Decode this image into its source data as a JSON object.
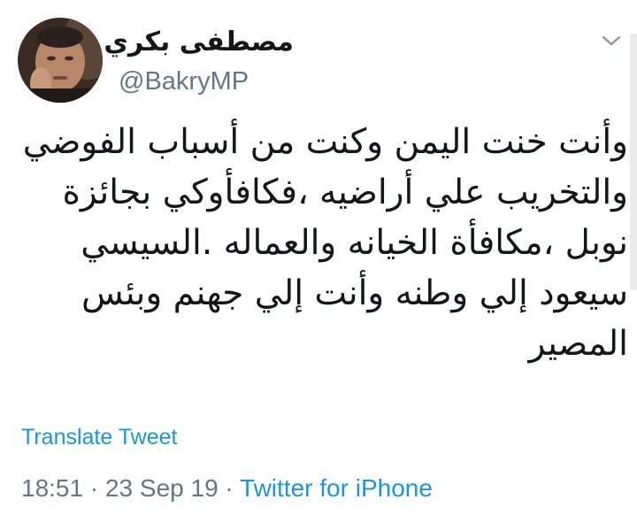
{
  "tweet": {
    "author": {
      "display_name": "مصطفى بكري",
      "handle": "@BakryMP",
      "verified": true,
      "verified_icon": "verified-badge-icon"
    },
    "menu_icon": "chevron-down-icon",
    "text_lines": [
      "وأنت خنت اليمن وكنت من أسباب الفوضي",
      "والتخريب علي أراضيه ،فكافأوكي بجائزة",
      "نوبل ،مكافأة الخيانه والعماله .السيسي",
      "سيعود إلي وطنه وأنت إلي جهنم وبئس",
      "المصير"
    ],
    "translate_label": "Translate Tweet",
    "time": "18:51",
    "separator": "·",
    "date": "23 Sep 19",
    "source": "Twitter for iPhone"
  },
  "colors": {
    "link": "#1b95e0",
    "secondary_text": "#657786",
    "primary_text": "#14171a",
    "verified": "#1da1f2"
  }
}
